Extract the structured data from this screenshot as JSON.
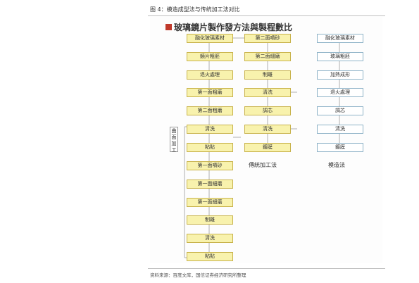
{
  "figure_caption": "图 4：模造成型法与传统加工法对比",
  "diagram": {
    "title": "玻璃鏡片製作發方法與製程數比",
    "col1": [
      "融化玻璃素材",
      "鏡片粗胚",
      "退火處理",
      "第一面粗磨",
      "第二面粗磨",
      "清洗",
      "粘貼",
      "第一面噴砂",
      "第一面細磨",
      "第一面細磨",
      "制離",
      "清洗",
      "粘貼"
    ],
    "col2": [
      "第二面噴砂",
      "第二面細磨",
      "制離",
      "清洗",
      "調芯",
      "清洗",
      "鍍膜"
    ],
    "col3": [
      "融化玻璃素材",
      "玻璃粗胚",
      "加熱成形",
      "退火處理",
      "調芯",
      "清洗",
      "鍍膜"
    ],
    "col1_side_label": "曲面加工",
    "col2_label": "傳統加工法",
    "col3_label": "模造法"
  },
  "source": "资料来源：百度文库，国信证券经济研究所整理",
  "colors": {
    "box_fill": "#f8f2ad",
    "box_border": "#c8b24a",
    "white_box_border": "#8fb3c8",
    "title_mark": "#c0392b"
  }
}
